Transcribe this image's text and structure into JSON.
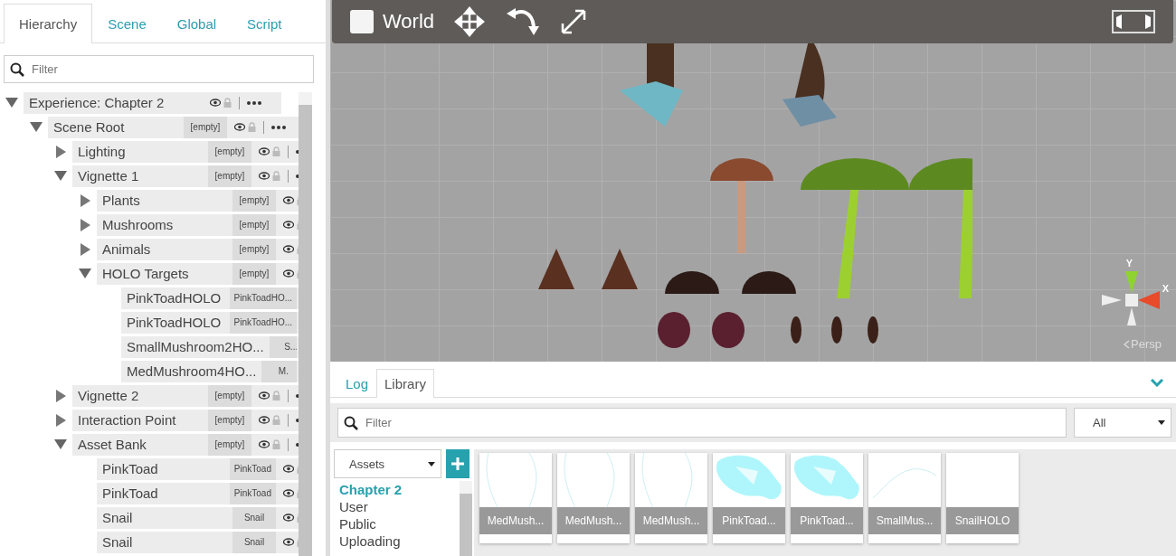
{
  "left_panel": {
    "tabs": [
      {
        "label": "Hierarchy",
        "selected": true
      },
      {
        "label": "Scene",
        "selected": false
      },
      {
        "label": "Global",
        "selected": false
      },
      {
        "label": "Script",
        "selected": false
      }
    ],
    "filter": {
      "placeholder": "Filter"
    },
    "tree": [
      {
        "name": "Experience: Chapter 2",
        "expanded": true,
        "children": [
          {
            "name": "Scene Root",
            "tag": "[empty]",
            "expanded": true,
            "children": [
              {
                "name": "Lighting",
                "tag": "[empty]",
                "expanded": false
              },
              {
                "name": "Vignette 1",
                "tag": "[empty]",
                "expanded": true,
                "children": [
                  {
                    "name": "Plants",
                    "tag": "[empty]",
                    "expanded": false
                  },
                  {
                    "name": "Mushrooms",
                    "tag": "[empty]",
                    "expanded": false
                  },
                  {
                    "name": "Animals",
                    "tag": "[empty]",
                    "expanded": false
                  },
                  {
                    "name": "HOLO Targets",
                    "tag": "[empty]",
                    "expanded": true,
                    "children": [
                      {
                        "name": "PinkToadHOLO",
                        "tag": "PinkToadHO..."
                      },
                      {
                        "name": "PinkToadHOLO",
                        "tag": "PinkToadHO..."
                      },
                      {
                        "name": "SmallMushroom2HO...",
                        "tag": "S..."
                      },
                      {
                        "name": "MedMushroom4HO...",
                        "tag": "M."
                      }
                    ]
                  }
                ]
              },
              {
                "name": "Vignette 2",
                "tag": "[empty]",
                "expanded": false
              },
              {
                "name": "Interaction Point",
                "tag": "[empty]",
                "expanded": false
              },
              {
                "name": "Asset Bank",
                "tag": "[empty]",
                "expanded": true,
                "children": [
                  {
                    "name": "PinkToad",
                    "tag": "PinkToad"
                  },
                  {
                    "name": "PinkToad",
                    "tag": "PinkToad"
                  },
                  {
                    "name": "Snail",
                    "tag": "Snail"
                  },
                  {
                    "name": "Snail",
                    "tag": "Snail"
                  }
                ]
              }
            ]
          }
        ]
      }
    ]
  },
  "viewport": {
    "world_toggle": {
      "label": "World",
      "checked": false
    },
    "gizmo": {
      "axis_labels": [
        "Y",
        "X"
      ],
      "projection": "Persp"
    }
  },
  "bottom_panel": {
    "tabs": [
      {
        "label": "Log",
        "selected": false
      },
      {
        "label": "Library",
        "selected": true
      }
    ],
    "filter": {
      "placeholder": "Filter"
    },
    "type_dropdown": "All",
    "source_dropdown": "Assets",
    "folders": [
      {
        "label": "Chapter 2",
        "selected": true
      },
      {
        "label": "User",
        "selected": false
      },
      {
        "label": "Public",
        "selected": false
      },
      {
        "label": "Uploading",
        "selected": false
      }
    ],
    "assets": [
      {
        "label": "MedMush...",
        "kind": "lines"
      },
      {
        "label": "MedMush...",
        "kind": "lines"
      },
      {
        "label": "MedMush...",
        "kind": "lines"
      },
      {
        "label": "PinkToad...",
        "kind": "blob"
      },
      {
        "label": "PinkToad...",
        "kind": "blob"
      },
      {
        "label": "SmallMus...",
        "kind": "arc"
      },
      {
        "label": "SnailHOLO",
        "kind": "blank"
      }
    ]
  }
}
